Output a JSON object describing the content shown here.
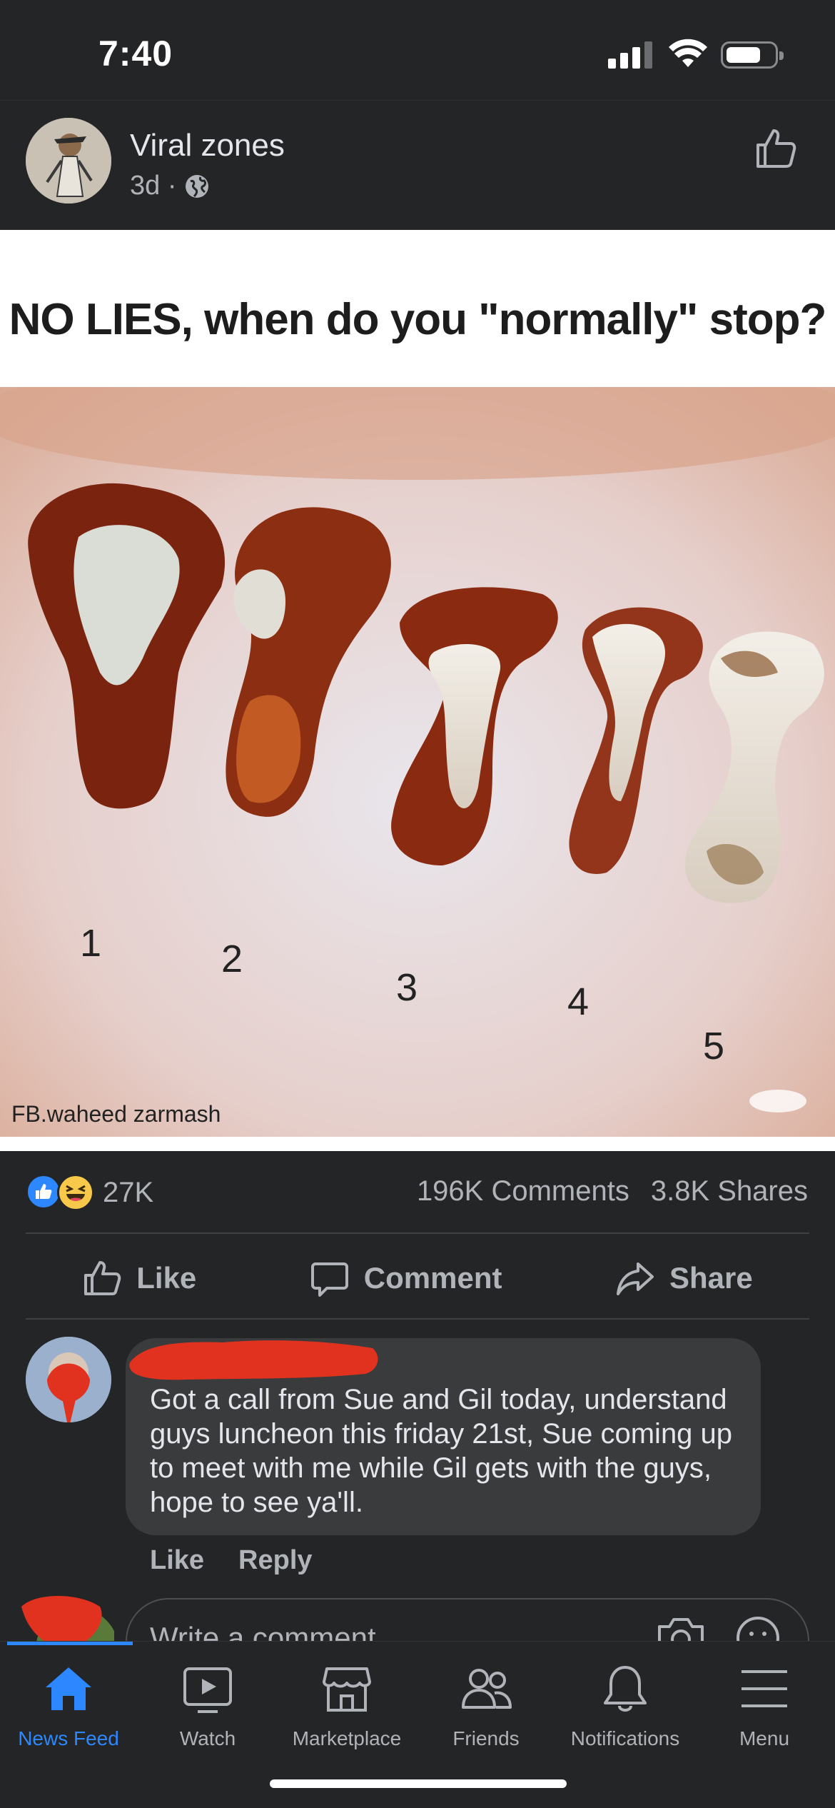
{
  "status_bar": {
    "time": "7:40"
  },
  "post": {
    "page_name": "Viral zones",
    "time_ago": "3d ·",
    "image": {
      "caption": "NO LIES, when do you \"normally\" stop?",
      "numbers": [
        "1",
        "2",
        "3",
        "4",
        "5"
      ],
      "watermark": "FB.waheed zarmash"
    },
    "reaction_count": "27K",
    "comments_count": "196K Comments",
    "shares_count": "3.8K Shares",
    "actions": {
      "like": "Like",
      "comment": "Comment",
      "share": "Share"
    }
  },
  "comment": {
    "text": "Got a call from Sue and Gil today, understand guys luncheon this friday 21st, Sue coming up to meet with me while Gil gets with the guys, hope to see ya'll.",
    "like": "Like",
    "reply": "Reply"
  },
  "write_comment": {
    "placeholder": "Write a comment..."
  },
  "tabs": [
    {
      "label": "News Feed",
      "icon": "home-icon",
      "active": true
    },
    {
      "label": "Watch",
      "icon": "watch-icon"
    },
    {
      "label": "Marketplace",
      "icon": "marketplace-icon"
    },
    {
      "label": "Friends",
      "icon": "friends-icon"
    },
    {
      "label": "Notifications",
      "icon": "bell-icon"
    },
    {
      "label": "Menu",
      "icon": "menu-icon"
    }
  ],
  "colors": {
    "background": "#242526",
    "accent": "#2d88ff",
    "secondary_text": "#b0b3b8",
    "bubble": "#3a3b3c",
    "redaction": "#e0321e"
  }
}
